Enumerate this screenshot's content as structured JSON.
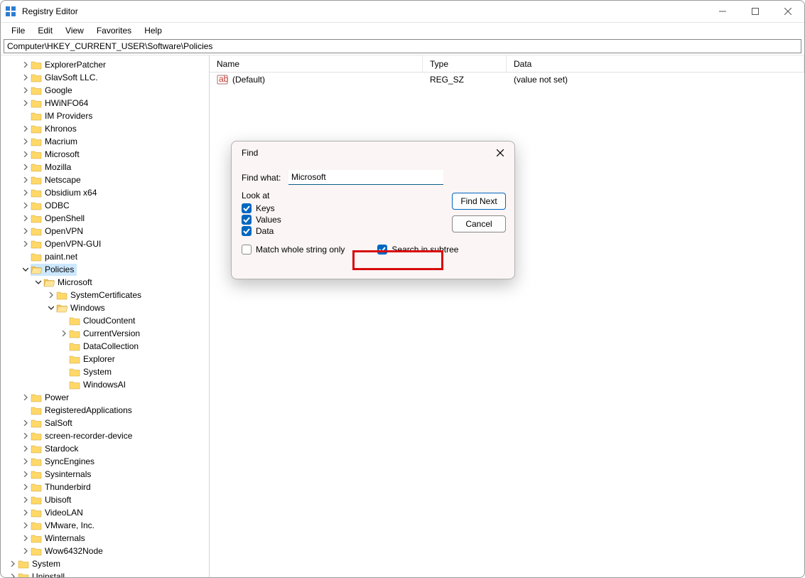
{
  "window": {
    "title": "Registry Editor"
  },
  "menu": {
    "file": "File",
    "edit": "Edit",
    "view": "View",
    "favorites": "Favorites",
    "help": "Help"
  },
  "address": "Computer\\HKEY_CURRENT_USER\\Software\\Policies",
  "columns": {
    "name": "Name",
    "type": "Type",
    "data": "Data"
  },
  "values": [
    {
      "name": "(Default)",
      "type": "REG_SZ",
      "data": "(value not set)"
    }
  ],
  "tree": {
    "items": [
      {
        "label": "ExplorerPatcher",
        "expandable": true,
        "indent": 3
      },
      {
        "label": "GlavSoft LLC.",
        "expandable": true,
        "indent": 3
      },
      {
        "label": "Google",
        "expandable": true,
        "indent": 3
      },
      {
        "label": "HWiNFO64",
        "expandable": true,
        "indent": 3
      },
      {
        "label": "IM Providers",
        "expandable": false,
        "indent": 3
      },
      {
        "label": "Khronos",
        "expandable": true,
        "indent": 3
      },
      {
        "label": "Macrium",
        "expandable": true,
        "indent": 3
      },
      {
        "label": "Microsoft",
        "expandable": true,
        "indent": 3
      },
      {
        "label": "Mozilla",
        "expandable": true,
        "indent": 3
      },
      {
        "label": "Netscape",
        "expandable": true,
        "indent": 3
      },
      {
        "label": "Obsidium x64",
        "expandable": true,
        "indent": 3
      },
      {
        "label": "ODBC",
        "expandable": true,
        "indent": 3
      },
      {
        "label": "OpenShell",
        "expandable": true,
        "indent": 3
      },
      {
        "label": "OpenVPN",
        "expandable": true,
        "indent": 3
      },
      {
        "label": "OpenVPN-GUI",
        "expandable": true,
        "indent": 3
      },
      {
        "label": "paint.net",
        "expandable": false,
        "indent": 3
      },
      {
        "label": "Policies",
        "expandable": true,
        "indent": 3,
        "expanded": true,
        "selected": true
      },
      {
        "label": "Microsoft",
        "expandable": true,
        "indent": 4,
        "expanded": true
      },
      {
        "label": "SystemCertificates",
        "expandable": true,
        "indent": 5
      },
      {
        "label": "Windows",
        "expandable": true,
        "indent": 5,
        "expanded": true
      },
      {
        "label": "CloudContent",
        "expandable": false,
        "indent": 6
      },
      {
        "label": "CurrentVersion",
        "expandable": true,
        "indent": 6
      },
      {
        "label": "DataCollection",
        "expandable": false,
        "indent": 6
      },
      {
        "label": "Explorer",
        "expandable": false,
        "indent": 6
      },
      {
        "label": "System",
        "expandable": false,
        "indent": 6
      },
      {
        "label": "WindowsAI",
        "expandable": false,
        "indent": 6
      },
      {
        "label": "Power",
        "expandable": true,
        "indent": 3
      },
      {
        "label": "RegisteredApplications",
        "expandable": false,
        "indent": 3
      },
      {
        "label": "SalSoft",
        "expandable": true,
        "indent": 3
      },
      {
        "label": "screen-recorder-device",
        "expandable": true,
        "indent": 3
      },
      {
        "label": "Stardock",
        "expandable": true,
        "indent": 3
      },
      {
        "label": "SyncEngines",
        "expandable": true,
        "indent": 3
      },
      {
        "label": "Sysinternals",
        "expandable": true,
        "indent": 3
      },
      {
        "label": "Thunderbird",
        "expandable": true,
        "indent": 3
      },
      {
        "label": "Ubisoft",
        "expandable": true,
        "indent": 3
      },
      {
        "label": "VideoLAN",
        "expandable": true,
        "indent": 3
      },
      {
        "label": "VMware, Inc.",
        "expandable": true,
        "indent": 3
      },
      {
        "label": "Winternals",
        "expandable": true,
        "indent": 3
      },
      {
        "label": "Wow6432Node",
        "expandable": true,
        "indent": 3
      },
      {
        "label": "System",
        "expandable": true,
        "indent": 2
      },
      {
        "label": "Uninstall",
        "expandable": true,
        "indent": 2
      }
    ]
  },
  "dialog": {
    "title": "Find",
    "find_what_label": "Find what:",
    "find_what_value": "Microsoft",
    "look_at_label": "Look at",
    "keys_label": "Keys",
    "values_label": "Values",
    "data_label": "Data",
    "keys_checked": true,
    "values_checked": true,
    "data_checked": true,
    "match_whole_label": "Match whole string only",
    "match_whole_checked": false,
    "search_subtree_label": "Search in subtree",
    "search_subtree_checked": true,
    "find_next_btn": "Find Next",
    "cancel_btn": "Cancel"
  }
}
